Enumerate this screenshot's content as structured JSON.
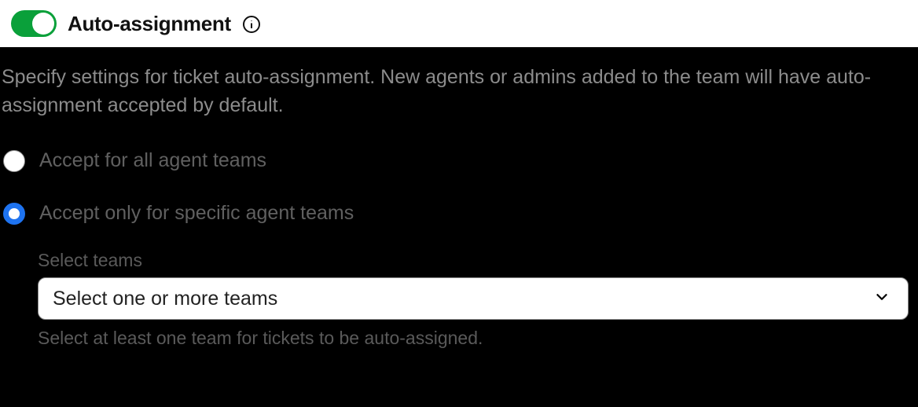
{
  "header": {
    "title": "Auto-assignment",
    "toggle_on": true
  },
  "description": "Specify settings for ticket auto-assignment. New agents or admins added to the team will have auto-assignment accepted by default.",
  "options": {
    "all_teams_label": "Accept for all agent teams",
    "specific_teams_label": "Accept only for specific agent teams"
  },
  "teams": {
    "label": "Select teams",
    "placeholder": "Select one or more teams",
    "hint": "Select at least one team for tickets to be auto-assigned."
  }
}
